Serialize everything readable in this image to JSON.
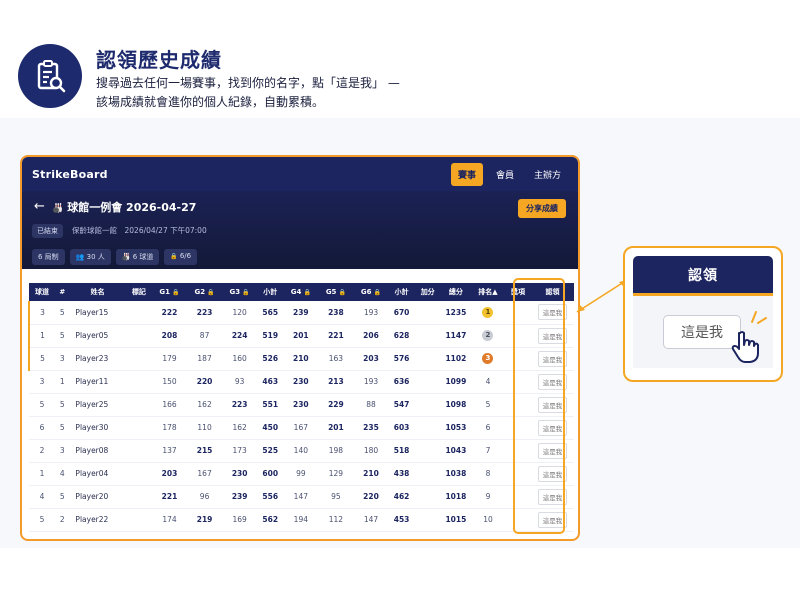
{
  "hero": {
    "title": "認領歷史成績",
    "desc_line1": "搜尋過去任何一場賽事，找到你的名字，點「這是我」 —",
    "desc_line2": "該場成績就會進你的個人紀錄，自動累積。",
    "icon": "clipboard-search-icon"
  },
  "app": {
    "brand": "StrikeBoard",
    "nav": [
      {
        "label": "賽事",
        "active": true
      },
      {
        "label": "會員",
        "active": false
      },
      {
        "label": "主辦方",
        "active": false
      }
    ],
    "event": {
      "title": "球館一例會 2026-04-27",
      "share_label": "分享成績",
      "status": "已結束",
      "meta": "保齡球館一館　2026/04/27 下午07:00",
      "chips": [
        "6 局制",
        "30 人",
        "6 球道",
        "6/6"
      ]
    },
    "table": {
      "headers": [
        "球道",
        "#",
        "姓名",
        "標記",
        "G1",
        "G2",
        "G3",
        "小計",
        "G4",
        "G5",
        "G6",
        "小計",
        "加分",
        "總分",
        "排名▲",
        "獎項",
        "認領"
      ],
      "claim_label": "這是我",
      "rows": [
        {
          "lane": "3",
          "no": "5",
          "name": "Player15",
          "g": [
            "222",
            "223",
            "120"
          ],
          "s1": "565",
          "g2": [
            "239",
            "238",
            "193"
          ],
          "s2": "670",
          "total": "1235",
          "rank": "1"
        },
        {
          "lane": "1",
          "no": "5",
          "name": "Player05",
          "g": [
            "208",
            "87",
            "224"
          ],
          "s1": "519",
          "g2": [
            "201",
            "221",
            "206"
          ],
          "s2": "628",
          "total": "1147",
          "rank": "2"
        },
        {
          "lane": "5",
          "no": "3",
          "name": "Player23",
          "g": [
            "179",
            "187",
            "160"
          ],
          "s1": "526",
          "g2": [
            "210",
            "163",
            "203"
          ],
          "s2": "576",
          "total": "1102",
          "rank": "3"
        },
        {
          "lane": "3",
          "no": "1",
          "name": "Player11",
          "g": [
            "150",
            "220",
            "93"
          ],
          "s1": "463",
          "g2": [
            "230",
            "213",
            "193"
          ],
          "s2": "636",
          "total": "1099",
          "rank": "4"
        },
        {
          "lane": "5",
          "no": "5",
          "name": "Player25",
          "g": [
            "166",
            "162",
            "223"
          ],
          "s1": "551",
          "g2": [
            "230",
            "229",
            "88"
          ],
          "s2": "547",
          "total": "1098",
          "rank": "5"
        },
        {
          "lane": "6",
          "no": "5",
          "name": "Player30",
          "g": [
            "178",
            "110",
            "162"
          ],
          "s1": "450",
          "g2": [
            "167",
            "201",
            "235"
          ],
          "s2": "603",
          "total": "1053",
          "rank": "6"
        },
        {
          "lane": "2",
          "no": "3",
          "name": "Player08",
          "g": [
            "137",
            "215",
            "173"
          ],
          "s1": "525",
          "g2": [
            "140",
            "198",
            "180"
          ],
          "s2": "518",
          "total": "1043",
          "rank": "7"
        },
        {
          "lane": "1",
          "no": "4",
          "name": "Player04",
          "g": [
            "203",
            "167",
            "230"
          ],
          "s1": "600",
          "g2": [
            "99",
            "129",
            "210"
          ],
          "s2": "438",
          "total": "1038",
          "rank": "8"
        },
        {
          "lane": "4",
          "no": "5",
          "name": "Player20",
          "g": [
            "221",
            "96",
            "239"
          ],
          "s1": "556",
          "g2": [
            "147",
            "95",
            "220"
          ],
          "s2": "462",
          "total": "1018",
          "rank": "9"
        },
        {
          "lane": "5",
          "no": "2",
          "name": "Player22",
          "g": [
            "174",
            "219",
            "169"
          ],
          "s1": "562",
          "g2": [
            "194",
            "112",
            "147"
          ],
          "s2": "453",
          "total": "1015",
          "rank": "10"
        }
      ]
    }
  },
  "callout": {
    "header": "認領",
    "button": "這是我",
    "icon": "pointer-hand-icon"
  },
  "colors": {
    "navy": "#1c2560",
    "accent": "#f5a623",
    "gold": "#f2c12e",
    "silver": "#c8ccd4",
    "bronze": "#e07b2a"
  }
}
